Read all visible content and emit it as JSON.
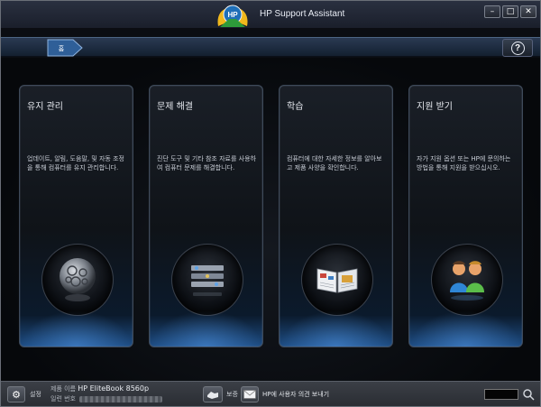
{
  "window": {
    "title": "HP Support Assistant",
    "logo_text": "HP",
    "controls": {
      "minimize": "–",
      "maximize": "□",
      "close": "✕"
    }
  },
  "navbar": {
    "home_label": "홈",
    "help_symbol": "?"
  },
  "cards": [
    {
      "title": "유지 관리",
      "description": "업데이트, 알림, 도움말, 및 자동 조정을 통해 컴퓨터를 유지 관리합니다.",
      "icon": "gear-sphere-icon"
    },
    {
      "title": "문제 해결",
      "description": "진단 도구 및 기타 참조 자료를 사용하여 컴퓨터 문제를 해결합니다.",
      "icon": "diagnostic-tools-icon"
    },
    {
      "title": "학습",
      "description": "컴퓨터에 대한 자세한 정보를 알아보고 제품 사양을 확인합니다.",
      "icon": "open-book-icon"
    },
    {
      "title": "지원 받기",
      "description": "자가 지원 옵션 또는 HP에 문의하는 방법을 통해 지원을 받으십시오.",
      "icon": "people-icon"
    }
  ],
  "footer": {
    "settings_label": "설정",
    "product_name_label": "제품 이름",
    "product_name_value": "HP EliteBook 8560p",
    "serial_label": "일련 번호",
    "warranty_label": "보증",
    "feedback_label": "HP에 사용자 의견 보내기"
  },
  "colors": {
    "accent_blue": "#1e4e86",
    "card_border": "#3e4a5a",
    "background": "#06080b"
  }
}
